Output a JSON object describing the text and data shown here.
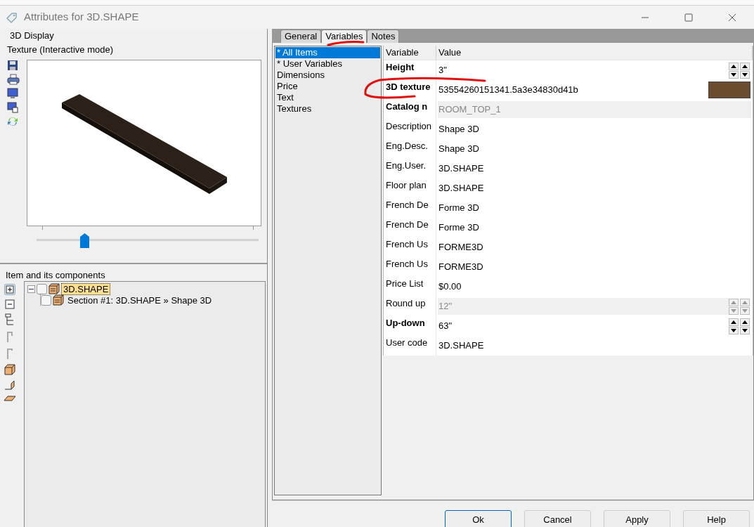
{
  "window": {
    "title": "Attributes for 3D.SHAPE"
  },
  "display": {
    "group_label": "3D Display",
    "mode_label": "Texture (Interactive mode)",
    "slider": {
      "level": 0.215
    }
  },
  "components": {
    "label": "Item and its components",
    "tree": [
      {
        "label": "3D.SHAPE",
        "expanded": true,
        "selected": true,
        "checked": false,
        "children": [
          {
            "label": "Section #1: 3D.SHAPE » Shape 3D",
            "selected": false,
            "checked": false
          }
        ]
      }
    ]
  },
  "tabs": [
    {
      "label": "General",
      "selected": false
    },
    {
      "label": "Variables",
      "selected": true
    },
    {
      "label": "Notes",
      "selected": false
    }
  ],
  "categories": [
    {
      "label": "* All Items",
      "selected": true
    },
    {
      "label": "* User Variables",
      "selected": false
    },
    {
      "label": "Dimensions",
      "selected": false
    },
    {
      "label": "Price",
      "selected": false
    },
    {
      "label": "Text",
      "selected": false
    },
    {
      "label": "Textures",
      "selected": false
    }
  ],
  "table": {
    "columns": [
      "Variable",
      "Value"
    ],
    "rows": [
      {
        "name": "Height",
        "value": "3\"",
        "bold": true,
        "kind": "spinner",
        "disabled": false
      },
      {
        "name": "3D texture",
        "value": "53554260151341.5a3e34830d41b",
        "bold": true,
        "kind": "color",
        "disabled": false,
        "color": "#6b4c2e"
      },
      {
        "name": "Catalog n",
        "value": "ROOM_TOP_1",
        "bold": true,
        "kind": "text",
        "disabled": true
      },
      {
        "name": "Description",
        "value": "Shape 3D",
        "bold": false,
        "kind": "text",
        "disabled": false
      },
      {
        "name": "Eng.Desc.",
        "value": "Shape 3D",
        "bold": false,
        "kind": "text",
        "disabled": false
      },
      {
        "name": "Eng.User.",
        "value": "3D.SHAPE",
        "bold": false,
        "kind": "text",
        "disabled": false
      },
      {
        "name": "Floor plan",
        "value": "3D.SHAPE",
        "bold": false,
        "kind": "text",
        "disabled": false
      },
      {
        "name": "French De",
        "value": "Forme 3D",
        "bold": false,
        "kind": "text",
        "disabled": false
      },
      {
        "name": "French De",
        "value": "Forme 3D",
        "bold": false,
        "kind": "text",
        "disabled": false
      },
      {
        "name": "French Us",
        "value": "FORME3D",
        "bold": false,
        "kind": "text",
        "disabled": false
      },
      {
        "name": "French Us",
        "value": "FORME3D",
        "bold": false,
        "kind": "text",
        "disabled": false
      },
      {
        "name": "Price List",
        "value": "$0.00",
        "bold": false,
        "kind": "text",
        "disabled": false
      },
      {
        "name": "Round up",
        "value": "12\"",
        "bold": false,
        "kind": "spinner",
        "disabled": true
      },
      {
        "name": "Up-down",
        "value": "63\"",
        "bold": true,
        "kind": "spinner",
        "disabled": false
      },
      {
        "name": "User code",
        "value": "3D.SHAPE",
        "bold": false,
        "kind": "text",
        "disabled": false
      }
    ]
  },
  "buttons": [
    {
      "label": "Ok",
      "default": true
    },
    {
      "label": "Cancel",
      "default": false
    },
    {
      "label": "Apply",
      "default": false
    },
    {
      "label": "Help",
      "default": false
    }
  ]
}
